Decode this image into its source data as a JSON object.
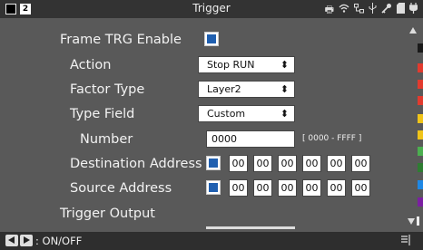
{
  "titlebar": {
    "title": "Trigger",
    "channel_num": "2",
    "icons": [
      "printer-icon",
      "wifi-icon",
      "network-icon",
      "usb-icon",
      "key-icon",
      "sd-card-icon",
      "power-plug-icon"
    ]
  },
  "rows": {
    "frame_trg_enable": {
      "label": "Frame TRG Enable",
      "checked": true
    },
    "action": {
      "label": "Action",
      "value": "Stop RUN"
    },
    "factor_type": {
      "label": "Factor Type",
      "value": "Layer2"
    },
    "type_field": {
      "label": "Type Field",
      "value": "Custom"
    },
    "number": {
      "label": "Number",
      "value": "0000",
      "range": "[ 0000 - FFFF ]"
    },
    "destination_address": {
      "label": "Destination Address",
      "checked": true,
      "octets": [
        "00",
        "00",
        "00",
        "00",
        "00",
        "00"
      ]
    },
    "source_address": {
      "label": "Source Address",
      "checked": true,
      "octets": [
        "00",
        "00",
        "00",
        "00",
        "00",
        "00"
      ]
    },
    "trigger_output": {
      "label": "Trigger Output"
    }
  },
  "bottombar": {
    "hint": ": ON/OFF"
  },
  "colors": {
    "accent": "#1f5fb0",
    "panel": "#595959",
    "side_markers": [
      "#1a1a1a",
      "#e23b2e",
      "#e23b2e",
      "#e23b2e",
      "#f0c419",
      "#f0c419",
      "#4caf50",
      "#2e7d32",
      "#1e88e5",
      "#7b1fa2",
      "#bdbdbd",
      "#ffffff"
    ]
  }
}
